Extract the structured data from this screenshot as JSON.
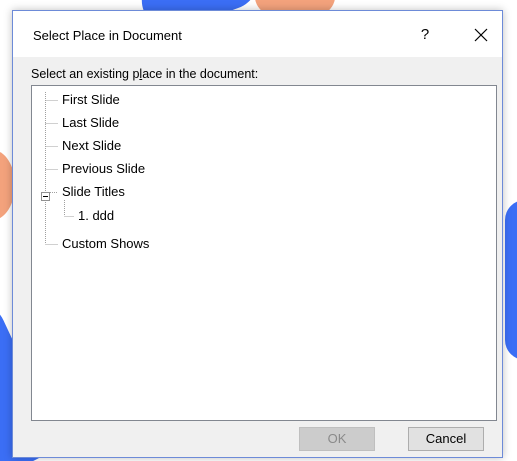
{
  "dialog": {
    "title": "Select Place in Document",
    "help_label": "?",
    "prompt_label_before": "Select an existing p",
    "prompt_label_accel": "l",
    "prompt_label_after": "ace in the document:"
  },
  "tree": {
    "items": [
      {
        "label": "First Slide"
      },
      {
        "label": "Last Slide"
      },
      {
        "label": "Next Slide"
      },
      {
        "label": "Previous Slide"
      },
      {
        "label": "Slide Titles",
        "expanded": true,
        "expander": "−"
      },
      {
        "label": "1. ddd"
      },
      {
        "label": "Custom Shows"
      }
    ]
  },
  "buttons": {
    "ok_label": "OK",
    "ok_enabled": false,
    "cancel_label": "Cancel"
  },
  "colors": {
    "dialog_border": "#6d8bd8",
    "dialog_bg": "#f0f0f0",
    "disabled_button_bg": "#cccccc",
    "decor_blue": "#3b6ef5",
    "decor_orange": "#f3a27c"
  }
}
